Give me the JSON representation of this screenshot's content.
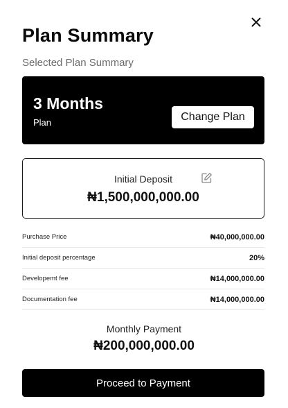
{
  "header": {
    "title": "Plan Summary",
    "subtitle": "Selected Plan Summary",
    "close_icon": "close-icon"
  },
  "plan": {
    "duration": "3 Months",
    "label": "Plan",
    "change_button": "Change Plan"
  },
  "deposit": {
    "label": "Initial Deposit",
    "amount": "₦1,500,000,000.00",
    "edit_icon": "edit-icon"
  },
  "details": [
    {
      "label": "Purchase Price",
      "value": "₦40,000,000.00"
    },
    {
      "label": "Initial deposit percentage",
      "value": "20%"
    },
    {
      "label": "Developemt fee",
      "value": "₦14,000,000.00"
    },
    {
      "label": "Documentation fee",
      "value": "₦14,000,000.00"
    }
  ],
  "monthly": {
    "label": "Monthly Payment",
    "amount": "₦200,000,000.00"
  },
  "actions": {
    "proceed": "Proceed to Payment"
  },
  "colors": {
    "primary": "#000000",
    "background": "#ffffff",
    "muted_text": "#6b6b6b",
    "divider": "#e6e6e6"
  }
}
